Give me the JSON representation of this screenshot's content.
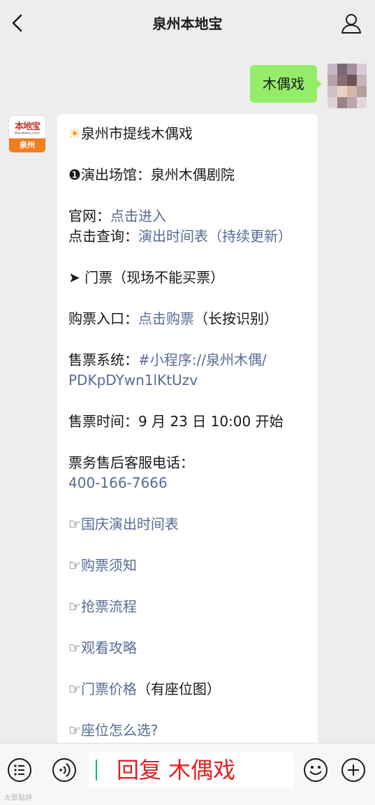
{
  "header": {
    "title": "泉州本地宝"
  },
  "conversation": {
    "user_message": "木偶戏",
    "account_avatar": {
      "logo_text": "本地宝",
      "logo_subtext": "Bendibao.com",
      "city": "泉州"
    },
    "reply": {
      "title": "泉州市提线木偶戏",
      "venue_line": "❶演出场馆：泉州木偶剧院",
      "website_label": "官网：",
      "website_link": "点击进入",
      "schedule_label": "点击查询：",
      "schedule_link": "演出时间表（持续更新）",
      "ticket_heading": "➤ 门票（现场不能买票）",
      "purchase_label": "购票入口：",
      "purchase_link": "点击购票",
      "purchase_note": "（长按识别）",
      "system_label": "售票系统：",
      "system_link_1": "#小程序://泉州木偶/",
      "system_link_2": "PDKpDYwn1lKtUzv",
      "sale_time": "售票时间：9 月 23 日 10:00 开始",
      "service_label": "票务售后客服电话：",
      "service_phone": "400-166-7666",
      "links": [
        {
          "pointer": "☞",
          "text": "国庆演出时间表",
          "note": ""
        },
        {
          "pointer": "☞",
          "text": "购票须知",
          "note": ""
        },
        {
          "pointer": "☞",
          "text": "抢票流程",
          "note": ""
        },
        {
          "pointer": "☞",
          "text": "观看攻略",
          "note": ""
        },
        {
          "pointer": "☞",
          "text": "门票价格",
          "note": "（有座位图）"
        },
        {
          "pointer": "☞",
          "text": "座位怎么选?",
          "note": ""
        }
      ]
    }
  },
  "input": {
    "typed_text": "回复 木偶戏"
  },
  "watermark": "大眾點評",
  "colors": {
    "self_bubble": "#95ec69",
    "link": "#576b95",
    "typed_text": "#e02020",
    "logo_orange": "#f07d1e"
  }
}
